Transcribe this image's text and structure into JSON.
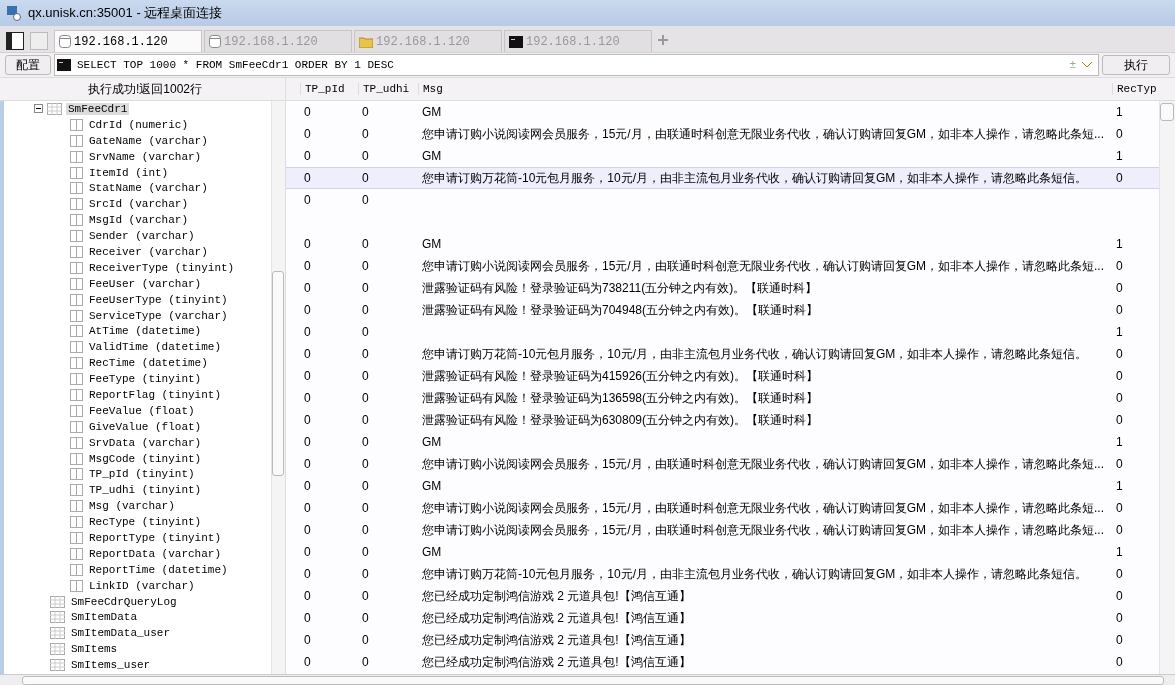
{
  "window": {
    "title": "qx.unisk.cn:35001 - 远程桌面连接"
  },
  "tabs": [
    {
      "kind": "db",
      "label": "192.168.1.120",
      "selected": true
    },
    {
      "kind": "db",
      "label": "192.168.1.120",
      "selected": false
    },
    {
      "kind": "folder",
      "label": "192.168.1.120",
      "selected": false
    },
    {
      "kind": "terminal",
      "label": "192.168.1.120",
      "selected": false
    }
  ],
  "toolbar": {
    "config_button": "配置",
    "query": "SELECT TOP 1000 * FROM SmFeeCdr1 ORDER BY 1 DESC",
    "plusminus": "±",
    "run_button": "执行"
  },
  "status": "执行成功!返回1002行",
  "tree": [
    {
      "label": "SmFeeCdr1",
      "expanded": true,
      "selected": true,
      "children": [
        {
          "label": "CdrId (numeric)"
        },
        {
          "label": "GateName (varchar)"
        },
        {
          "label": "SrvName (varchar)"
        },
        {
          "label": "ItemId (int)"
        },
        {
          "label": "StatName (varchar)"
        },
        {
          "label": "SrcId (varchar)"
        },
        {
          "label": "MsgId (varchar)"
        },
        {
          "label": "Sender (varchar)"
        },
        {
          "label": "Receiver (varchar)"
        },
        {
          "label": "ReceiverType (tinyint)"
        },
        {
          "label": "FeeUser (varchar)"
        },
        {
          "label": "FeeUserType (tinyint)"
        },
        {
          "label": "ServiceType (varchar)"
        },
        {
          "label": "AtTime (datetime)"
        },
        {
          "label": "ValidTime (datetime)"
        },
        {
          "label": "RecTime (datetime)"
        },
        {
          "label": "FeeType (tinyint)"
        },
        {
          "label": "ReportFlag (tinyint)"
        },
        {
          "label": "FeeValue (float)"
        },
        {
          "label": "GiveValue (float)"
        },
        {
          "label": "SrvData (varchar)"
        },
        {
          "label": "MsgCode (tinyint)"
        },
        {
          "label": "TP_pId (tinyint)"
        },
        {
          "label": "TP_udhi (tinyint)"
        },
        {
          "label": "Msg (varchar)"
        },
        {
          "label": "RecType (tinyint)"
        },
        {
          "label": "ReportType (tinyint)"
        },
        {
          "label": "ReportData (varchar)"
        },
        {
          "label": "ReportTime (datetime)"
        },
        {
          "label": "LinkID (varchar)"
        }
      ]
    },
    {
      "label": "SmFeeCdrQueryLog",
      "selected": false
    },
    {
      "label": "SmItemData",
      "selected": false
    },
    {
      "label": "SmItemData_user",
      "selected": false
    },
    {
      "label": "SmItems",
      "selected": false
    },
    {
      "label": "SmItems_user",
      "selected": false
    }
  ],
  "table": {
    "columns": [
      "TP_pId",
      "TP_udhi",
      "Msg",
      "RecTyp"
    ],
    "rows": [
      {
        "selected": false,
        "kind": "single",
        "cells": [
          "0",
          "0",
          "GM",
          "1"
        ]
      },
      {
        "selected": false,
        "kind": "single",
        "cells": [
          "0",
          "0",
          "您申请订购小说阅读网会员服务，15元/月，由联通时科创意无限业务代收，确认订购请回复GM，如非本人操作，请忽略此条短...",
          "0"
        ]
      },
      {
        "selected": false,
        "kind": "single",
        "cells": [
          "0",
          "0",
          "GM",
          "1"
        ]
      },
      {
        "selected": true,
        "kind": "single",
        "cells": [
          "0",
          "0",
          "您申请订购万花筒-10元包月服务，10元/月，由非主流包月业务代收，确认订购请回复GM，如非本人操作，请忽略此条短信。",
          "0"
        ]
      },
      {
        "selected": false,
        "kind": "double",
        "cells": [
          "0",
          "0"
        ]
      },
      {
        "selected": false,
        "kind": "single",
        "cells": [
          "0",
          "0",
          "GM",
          "1"
        ]
      },
      {
        "selected": false,
        "kind": "single",
        "cells": [
          "0",
          "0",
          "您申请订购小说阅读网会员服务，15元/月，由联通时科创意无限业务代收，确认订购请回复GM，如非本人操作，请忽略此条短...",
          "0"
        ]
      },
      {
        "selected": false,
        "kind": "single",
        "cells": [
          "0",
          "0",
          "泄露验证码有风险！登录验证码为738211(五分钟之内有效)。【联通时科】",
          "0"
        ]
      },
      {
        "selected": false,
        "kind": "single",
        "cells": [
          "0",
          "0",
          "泄露验证码有风险！登录验证码为704948(五分钟之内有效)。【联通时科】",
          "0"
        ]
      },
      {
        "selected": false,
        "kind": "single",
        "cells": [
          "0",
          "0",
          "",
          "1"
        ]
      },
      {
        "selected": false,
        "kind": "single",
        "cells": [
          "0",
          "0",
          "您申请订购万花筒-10元包月服务，10元/月，由非主流包月业务代收，确认订购请回复GM，如非本人操作，请忽略此条短信。",
          "0"
        ]
      },
      {
        "selected": false,
        "kind": "single",
        "cells": [
          "0",
          "0",
          "泄露验证码有风险！登录验证码为415926(五分钟之内有效)。【联通时科】",
          "0"
        ]
      },
      {
        "selected": false,
        "kind": "single",
        "cells": [
          "0",
          "0",
          "泄露验证码有风险！登录验证码为136598(五分钟之内有效)。【联通时科】",
          "0"
        ]
      },
      {
        "selected": false,
        "kind": "single",
        "cells": [
          "0",
          "0",
          "泄露验证码有风险！登录验证码为630809(五分钟之内有效)。【联通时科】",
          "0"
        ]
      },
      {
        "selected": false,
        "kind": "single",
        "cells": [
          "0",
          "0",
          "GM",
          "1"
        ]
      },
      {
        "selected": false,
        "kind": "single",
        "cells": [
          "0",
          "0",
          "您申请订购小说阅读网会员服务，15元/月，由联通时科创意无限业务代收，确认订购请回复GM，如非本人操作，请忽略此条短...",
          "0"
        ]
      },
      {
        "selected": false,
        "kind": "single",
        "cells": [
          "0",
          "0",
          "GM",
          "1"
        ]
      },
      {
        "selected": false,
        "kind": "single",
        "cells": [
          "0",
          "0",
          "您申请订购小说阅读网会员服务，15元/月，由联通时科创意无限业务代收，确认订购请回复GM，如非本人操作，请忽略此条短...",
          "0"
        ]
      },
      {
        "selected": false,
        "kind": "single",
        "cells": [
          "0",
          "0",
          "您申请订购小说阅读网会员服务，15元/月，由联通时科创意无限业务代收，确认订购请回复GM，如非本人操作，请忽略此条短...",
          "0"
        ]
      },
      {
        "selected": false,
        "kind": "single",
        "cells": [
          "0",
          "0",
          "GM",
          "1"
        ]
      },
      {
        "selected": false,
        "kind": "single",
        "cells": [
          "0",
          "0",
          "您申请订购万花筒-10元包月服务，10元/月，由非主流包月业务代收，确认订购请回复GM，如非本人操作，请忽略此条短信。",
          "0"
        ]
      },
      {
        "selected": false,
        "kind": "single",
        "cells": [
          "0",
          "0",
          "您已经成功定制鸿信游戏 2 元道具包!【鸿信互通】",
          "0"
        ]
      },
      {
        "selected": false,
        "kind": "single",
        "cells": [
          "0",
          "0",
          "您已经成功定制鸿信游戏 2 元道具包!【鸿信互通】",
          "0"
        ]
      },
      {
        "selected": false,
        "kind": "single",
        "cells": [
          "0",
          "0",
          "您已经成功定制鸿信游戏 2 元道具包!【鸿信互通】",
          "0"
        ]
      },
      {
        "selected": false,
        "kind": "single",
        "cells": [
          "0",
          "0",
          "您已经成功定制鸿信游戏 2 元道具包!【鸿信互通】",
          "0"
        ]
      }
    ]
  }
}
